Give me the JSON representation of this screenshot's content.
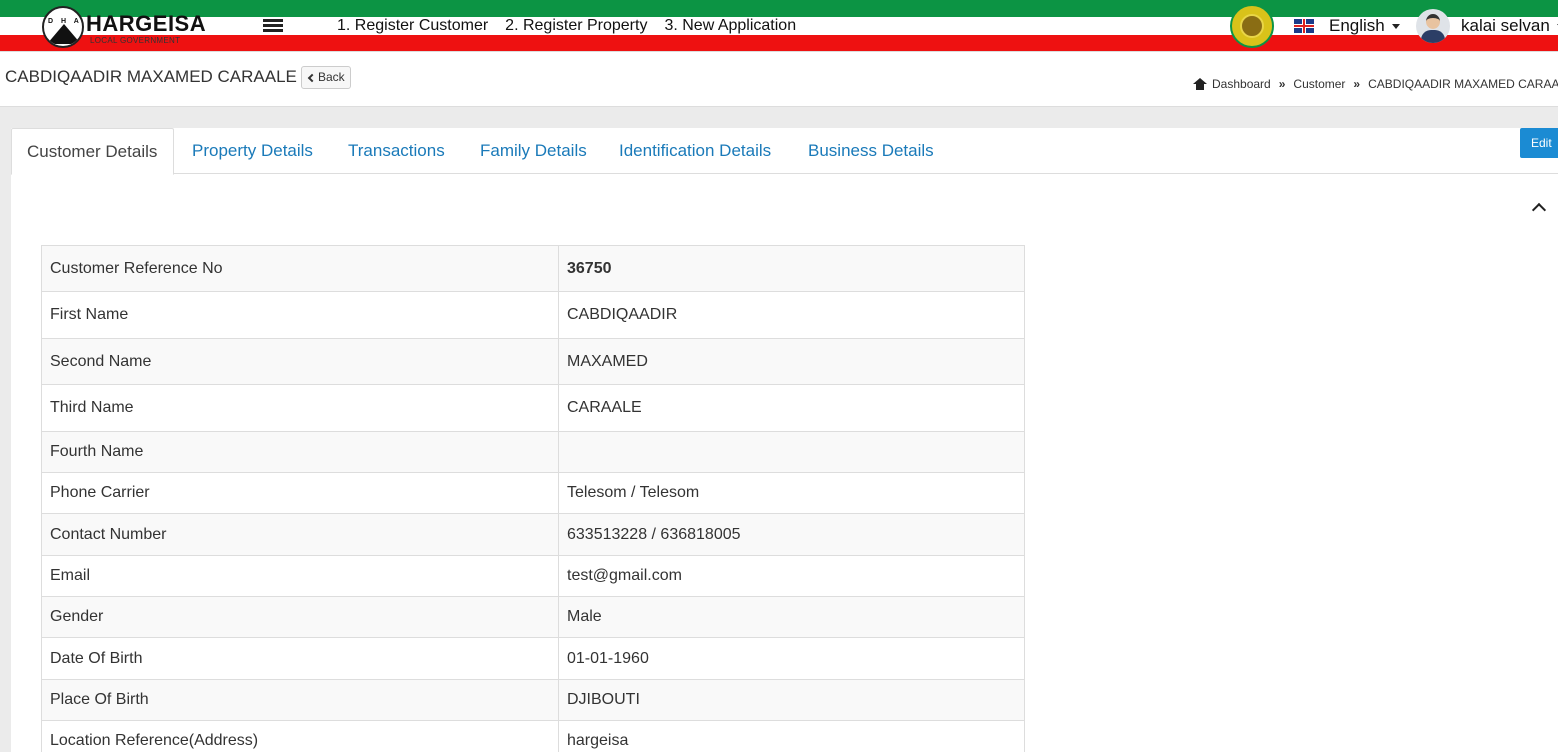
{
  "header": {
    "logo_title": "HARGEISA",
    "logo_subtitle": "LOCAL GOVERNMENT",
    "logo_initials": "D H A",
    "nav": [
      {
        "label": "1. Register Customer"
      },
      {
        "label": "2. Register Property"
      },
      {
        "label": "3. New Application"
      }
    ],
    "language": "English",
    "user_name": "kalai selvan",
    "colors": {
      "stripe_green": "#0c9444",
      "stripe_red": "#ee1111",
      "link_blue": "#1a7ab9",
      "edit_button": "#1b8bd3"
    }
  },
  "page": {
    "title": "CABDIQAADIR MAXAMED CARAALE",
    "back_label": "Back",
    "breadcrumb": {
      "home": "Dashboard",
      "section": "Customer",
      "current": "CABDIQAADIR MAXAMED CARAALE"
    }
  },
  "tabs": [
    {
      "label": "Customer Details",
      "active": true
    },
    {
      "label": "Property Details"
    },
    {
      "label": "Transactions"
    },
    {
      "label": "Family Details"
    },
    {
      "label": "Identification Details"
    },
    {
      "label": "Business Details"
    }
  ],
  "edit_label": "Edit",
  "details": [
    {
      "label": "Customer Reference No",
      "value": "36750",
      "bold": true
    },
    {
      "label": "First Name",
      "value": "CABDIQAADIR"
    },
    {
      "label": "Second Name",
      "value": "MAXAMED"
    },
    {
      "label": "Third Name",
      "value": "CARAALE"
    },
    {
      "label": "Fourth Name",
      "value": ""
    },
    {
      "label": "Phone Carrier",
      "value": "Telesom / Telesom"
    },
    {
      "label": "Contact Number",
      "value": "633513228 / 636818005"
    },
    {
      "label": "Email",
      "value": "test@gmail.com"
    },
    {
      "label": "Gender",
      "value": "Male"
    },
    {
      "label": "Date Of Birth",
      "value": "01-01-1960"
    },
    {
      "label": "Place Of Birth",
      "value": "DJIBOUTI"
    },
    {
      "label": "Location Reference(Address)",
      "value": "hargeisa"
    }
  ]
}
